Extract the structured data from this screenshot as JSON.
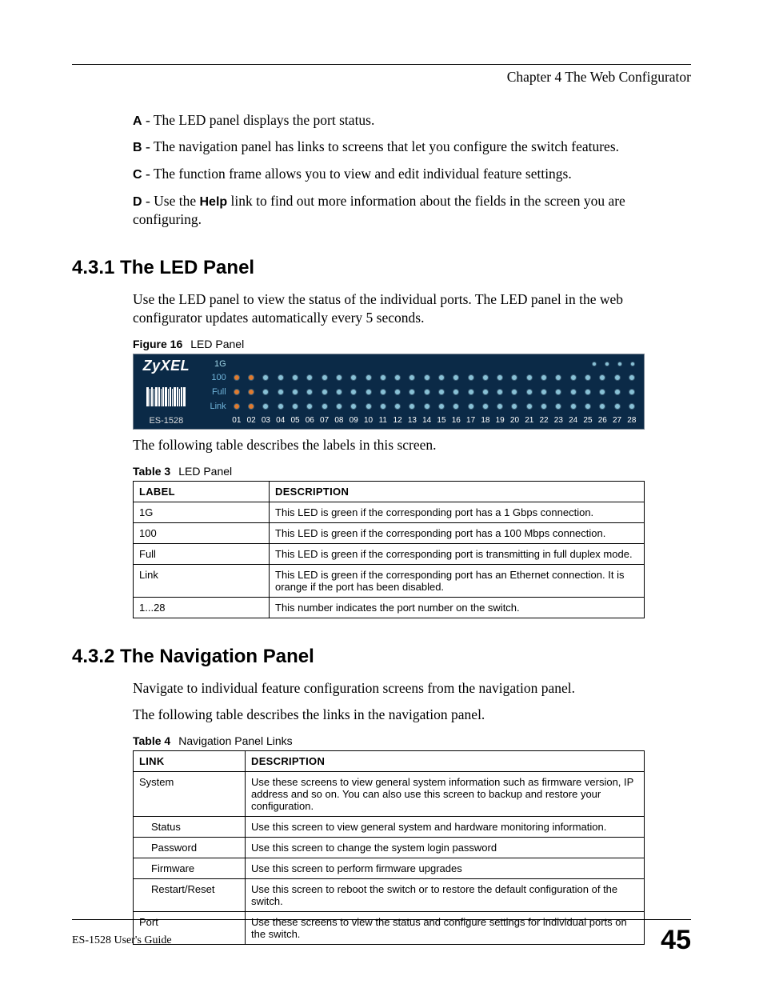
{
  "header": {
    "chapter": "Chapter 4 The Web Configurator"
  },
  "intro": {
    "A": {
      "label": "A",
      "text": " - The LED panel displays the port status."
    },
    "B": {
      "label": "B",
      "text": " - The navigation panel has links to screens that let you configure the switch features."
    },
    "C": {
      "label": "C",
      "text": " - The function frame allows you to view and edit individual feature settings."
    },
    "D": {
      "label_pre": "D",
      "text_pre": " - Use the ",
      "bold": "Help",
      "text_post": " link to find out more information about the fields in the screen you are configuring."
    }
  },
  "section1": {
    "heading": "4.3.1  The LED Panel",
    "para": "Use the LED panel to view the status of the individual ports. The LED panel in the web configurator updates automatically every 5 seconds.",
    "fig_caption_bold": "Figure 16",
    "fig_caption_rest": "LED Panel",
    "after_fig": "The following table describes the labels in this screen.",
    "tbl_caption_bold": "Table 3",
    "tbl_caption_rest": "LED Panel",
    "table": {
      "headers": [
        "LABEL",
        "DESCRIPTION"
      ],
      "rows": [
        {
          "label": "1G",
          "desc": "This LED is green if the corresponding port has a 1 Gbps connection."
        },
        {
          "label": "100",
          "desc": "This LED is green if the corresponding port has a 100 Mbps connection."
        },
        {
          "label": "Full",
          "desc": "This LED is green if the corresponding port is transmitting in full duplex mode."
        },
        {
          "label": "Link",
          "desc": "This LED is green if the corresponding port has an Ethernet connection. It is orange if the port has been disabled."
        },
        {
          "label": "1...28",
          "desc": "This number indicates the port number on the switch."
        }
      ]
    }
  },
  "section2": {
    "heading": "4.3.2  The Navigation Panel",
    "para1": "Navigate to individual feature configuration screens from the navigation panel.",
    "para2": "The following table describes the links in the navigation panel.",
    "tbl_caption_bold": "Table 4",
    "tbl_caption_rest": "Navigation Panel Links",
    "table": {
      "headers": [
        "LINK",
        "DESCRIPTION"
      ],
      "rows": [
        {
          "link": "System",
          "sub": false,
          "desc": "Use these screens to view general system information such as firmware version, IP address and so on. You can also use this screen to backup and restore your configuration."
        },
        {
          "link": "Status",
          "sub": true,
          "desc": "Use this screen to view general system and hardware monitoring information."
        },
        {
          "link": "Password",
          "sub": true,
          "desc": "Use this screen to change the system login password"
        },
        {
          "link": "Firmware",
          "sub": true,
          "desc": "Use this screen to perform firmware upgrades"
        },
        {
          "link": "Restart/Reset",
          "sub": true,
          "desc": "Use this screen to reboot the switch or to restore the default configuration of the switch."
        },
        {
          "link": "Port",
          "sub": false,
          "desc": "Use these screens to view the status and configure settings for individual ports on the switch."
        }
      ]
    }
  },
  "led_panel": {
    "brand": "ZyXEL",
    "model": "ES-1528",
    "rows": {
      "top_label": "1G",
      "r100": "100",
      "rfull": "Full",
      "rlink": "Link"
    },
    "port_count": 28,
    "uplinks": 4,
    "active_ports": {
      "100": [
        1,
        2
      ],
      "Full": [
        1,
        2
      ],
      "Link": [
        1,
        2
      ]
    }
  },
  "footer": {
    "guide": "ES-1528 User's Guide",
    "page": "45"
  }
}
